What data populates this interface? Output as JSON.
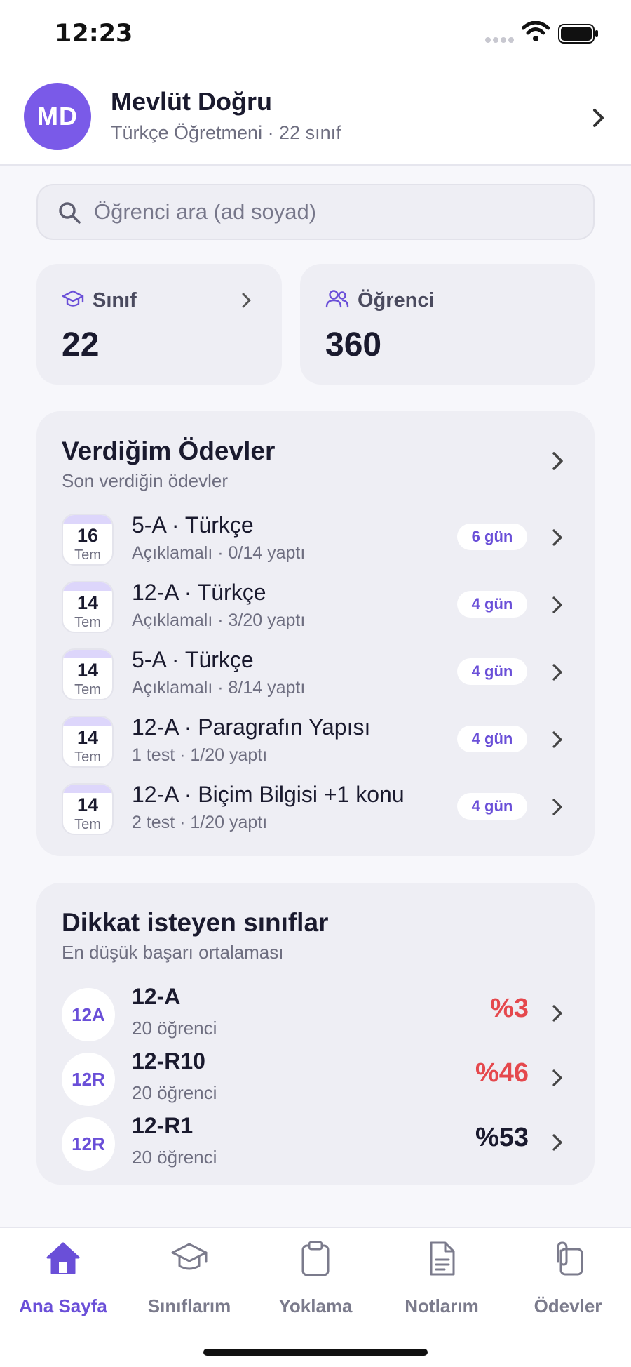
{
  "status_bar": {
    "time": "12:23"
  },
  "profile": {
    "initials": "MD",
    "name": "Mevlüt Doğru",
    "subtitle": "Türkçe Öğretmeni · 22 sınıf"
  },
  "search": {
    "placeholder": "Öğrenci ara (ad soyad)",
    "value": ""
  },
  "stats": {
    "classes": {
      "label": "Sınıf",
      "value": "22",
      "icon": "graduation-cap-icon"
    },
    "students": {
      "label": "Öğrenci",
      "value": "360",
      "icon": "users-icon"
    }
  },
  "assignments": {
    "title": "Verdiğim Ödevler",
    "subtitle": "Son verdiğin ödevler",
    "items": [
      {
        "day": "16",
        "month": "Tem",
        "title": "5-A · Türkçe",
        "sub": "Açıklamalı · 0/14 yaptı",
        "days": "6 gün"
      },
      {
        "day": "14",
        "month": "Tem",
        "title": "12-A · Türkçe",
        "sub": "Açıklamalı · 3/20 yaptı",
        "days": "4 gün"
      },
      {
        "day": "14",
        "month": "Tem",
        "title": "5-A · Türkçe",
        "sub": "Açıklamalı · 8/14 yaptı",
        "days": "4 gün"
      },
      {
        "day": "14",
        "month": "Tem",
        "title": "12-A · Paragrafın Yapısı",
        "sub": "1 test · 1/20 yaptı",
        "days": "4 gün"
      },
      {
        "day": "14",
        "month": "Tem",
        "title": "12-A · Biçim Bilgisi +1 konu",
        "sub": "2 test · 1/20 yaptı",
        "days": "4 gün"
      }
    ]
  },
  "attention": {
    "title": "Dikkat isteyen sınıflar",
    "subtitle": "En düşük başarı ortalaması",
    "items": [
      {
        "badge": "12A",
        "name": "12-A",
        "sub": "20 öğrenci",
        "score": "%3",
        "score_color": "#e5484d"
      },
      {
        "badge": "12R",
        "name": "12-R10",
        "sub": "20 öğrenci",
        "score": "%46",
        "score_color": "#e5484d"
      },
      {
        "badge": "12R",
        "name": "12-R1",
        "sub": "20 öğrenci",
        "score": "%53",
        "score_color": "#1a1a2e"
      }
    ]
  },
  "tabs": [
    {
      "label": "Ana Sayfa",
      "icon": "home-icon",
      "active": true
    },
    {
      "label": "Sınıflarım",
      "icon": "graduation-cap-icon",
      "active": false
    },
    {
      "label": "Yoklama",
      "icon": "clipboard-icon",
      "active": false
    },
    {
      "label": "Notlarım",
      "icon": "document-icon",
      "active": false
    },
    {
      "label": "Ödevler",
      "icon": "paperclip-icon",
      "active": false
    }
  ],
  "colors": {
    "accent": "#6a4fd8",
    "avatar": "#7a5ae8",
    "danger": "#e5484d"
  }
}
